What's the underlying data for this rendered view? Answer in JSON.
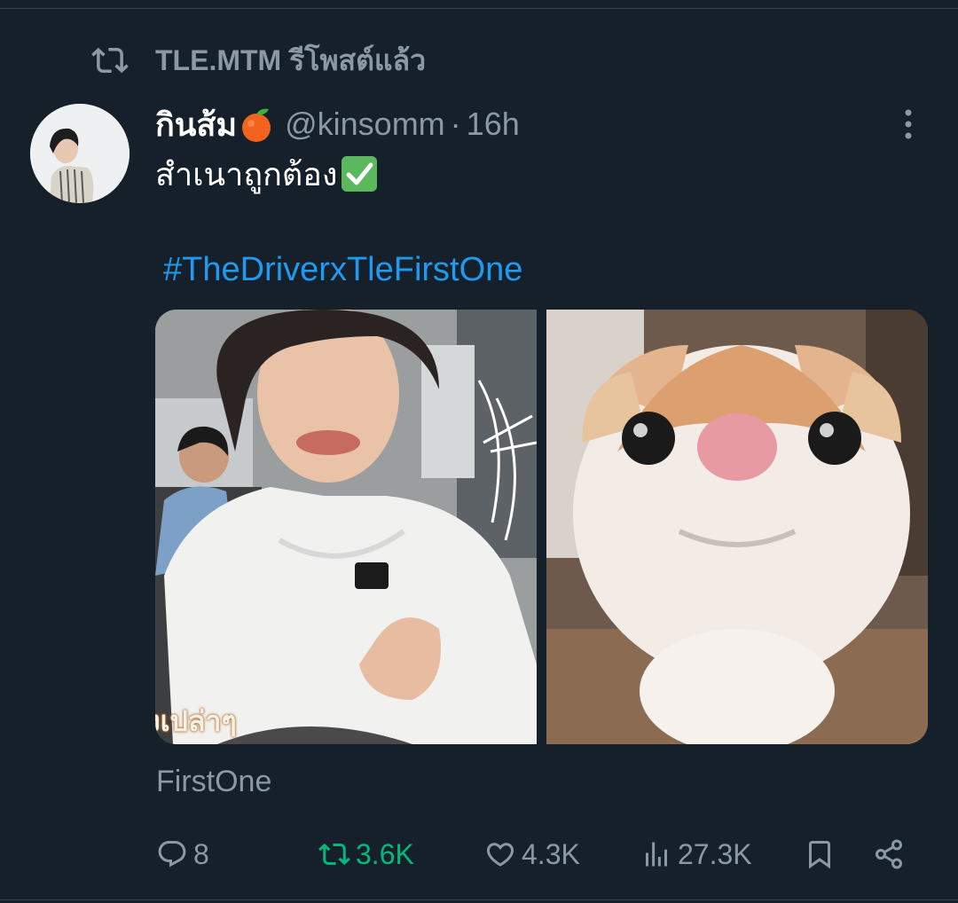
{
  "retweet_banner": {
    "text": "TLE.MTM รีโพสต์แล้ว"
  },
  "tweet": {
    "display_name": "กินส้ม",
    "handle": "@kinsomm",
    "separator": "·",
    "time": "16h",
    "text": "สำเนาถูกต้อง",
    "hashtag": "#TheDriverxTleFirstOne",
    "card_source": "FirstOne",
    "media_left_caption": "งเปล่าๆ"
  },
  "actions": {
    "replies": "8",
    "retweets": "3.6K",
    "likes": "4.3K",
    "views": "27.3K"
  },
  "colors": {
    "background": "#15202b",
    "secondary_text": "#8b98a5",
    "link": "#1d9bf0",
    "retweeted": "#00ba7c",
    "divider": "#38444d"
  },
  "icons": [
    "retweet-icon",
    "orange-emoji",
    "check-mark-emoji",
    "more-icon",
    "reply-icon",
    "retweet-icon",
    "like-icon",
    "views-icon",
    "bookmark-icon",
    "share-icon"
  ]
}
